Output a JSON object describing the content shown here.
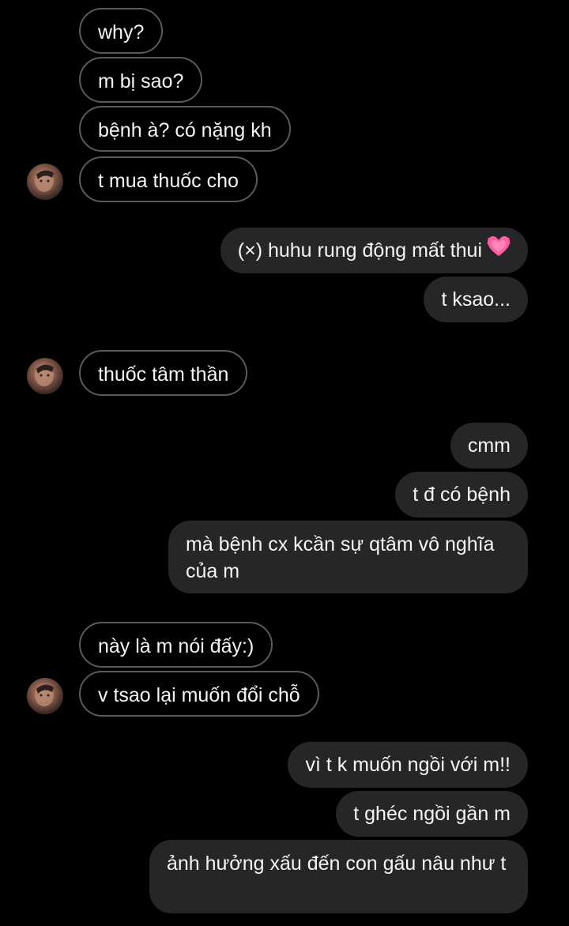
{
  "colors": {
    "background": "#000000",
    "received_border": "#5a5a5c",
    "sent_bubble": "#262629",
    "text": "#f5f5f5",
    "heart": "#ff5fa2"
  },
  "messages": [
    {
      "id": "m1",
      "side": "received",
      "text": "why?"
    },
    {
      "id": "m2",
      "side": "received",
      "text": "m bị sao?"
    },
    {
      "id": "m3",
      "side": "received",
      "text": "bệnh à? có nặng kh"
    },
    {
      "id": "m4",
      "side": "received",
      "text": "t mua thuốc cho"
    },
    {
      "id": "m5",
      "side": "sent",
      "text": "(×) huhu rung động mất thui",
      "emoji": "growing-heart-icon"
    },
    {
      "id": "m6",
      "side": "sent",
      "text": "t ksao..."
    },
    {
      "id": "m7",
      "side": "received",
      "text": "thuốc tâm thần"
    },
    {
      "id": "m8",
      "side": "sent",
      "text": "cmm"
    },
    {
      "id": "m9",
      "side": "sent",
      "text": "t đ có bệnh"
    },
    {
      "id": "m10",
      "side": "sent",
      "text": "mà bệnh cx kcần sự qtâm vô nghĩa của m"
    },
    {
      "id": "m11",
      "side": "received",
      "text": "này là m nói đấy:)"
    },
    {
      "id": "m12",
      "side": "received",
      "text": "v tsao lại muốn đổi chỗ"
    },
    {
      "id": "m13",
      "side": "sent",
      "text": "vì t k muốn ngồi với m!!"
    },
    {
      "id": "m14",
      "side": "sent",
      "text": "t ghéc ngồi gần m"
    },
    {
      "id": "m15",
      "side": "sent",
      "text": "ảnh hưởng xấu đến con gấu nâu như t"
    }
  ]
}
